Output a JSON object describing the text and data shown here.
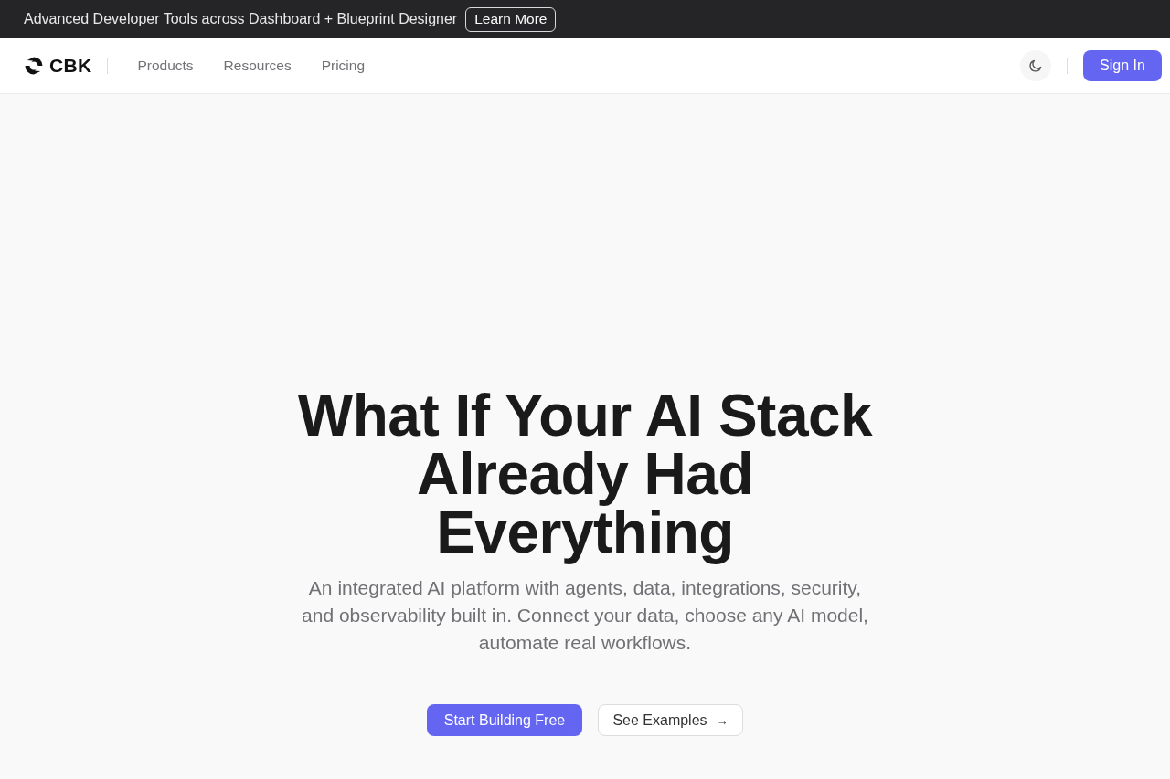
{
  "announcement": {
    "text": "Advanced Developer Tools across Dashboard + Blueprint Designer",
    "link": "Learn More"
  },
  "nav": {
    "brand": "CBK",
    "links": [
      {
        "label": "Products"
      },
      {
        "label": "Resources"
      },
      {
        "label": "Pricing"
      }
    ],
    "sign_in": "Sign In"
  },
  "hero": {
    "title_lines": [
      "What If Your AI Stack",
      "Already Had",
      "Everything"
    ],
    "subtitle_lines": [
      "An integrated AI platform with agents, data, integrations, security,",
      "and observability built in. Connect your data, choose any AI model,",
      "automate real workflows."
    ],
    "primary_button": "Start Building Free",
    "secondary_button": {
      "label": "See Examples",
      "arrow": "→"
    }
  }
}
